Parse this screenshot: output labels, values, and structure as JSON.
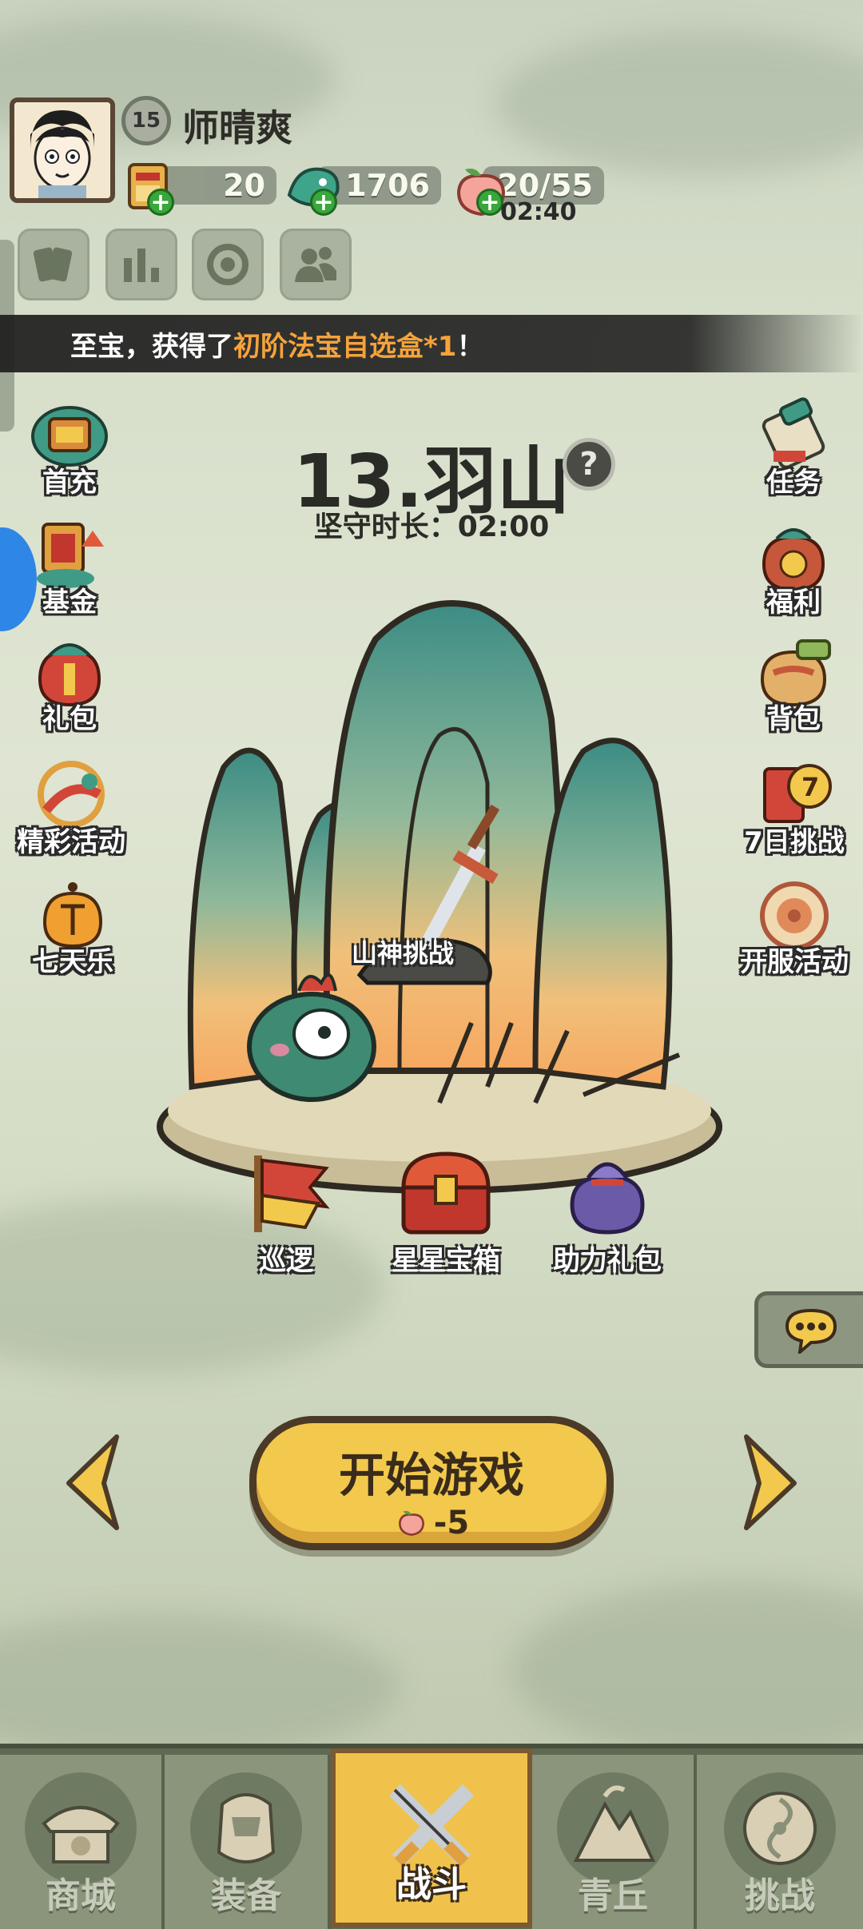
{
  "player": {
    "name": "师晴爽",
    "level": "15"
  },
  "resources": {
    "tickets": "20",
    "jade": "1706",
    "stamina": "20/55",
    "stamina_timer": "02:40"
  },
  "ticker": {
    "prefix": "至宝，获得了",
    "highlight": "初阶法宝自选盒*1",
    "suffix": "！"
  },
  "stage": {
    "title": "13.羽山",
    "hold_time": "坚守时长：02:00",
    "boss_label": "山神挑战"
  },
  "left_menu": [
    {
      "label": "首充",
      "icon": "first-recharge-icon"
    },
    {
      "label": "基金",
      "icon": "fund-icon"
    },
    {
      "label": "礼包",
      "icon": "gift-pack-icon"
    },
    {
      "label": "精彩活动",
      "icon": "events-icon"
    },
    {
      "label": "七天乐",
      "icon": "seven-day-icon"
    }
  ],
  "right_menu": [
    {
      "label": "任务",
      "icon": "quest-scroll-icon"
    },
    {
      "label": "福利",
      "icon": "welfare-bag-icon"
    },
    {
      "label": "背包",
      "icon": "backpack-icon"
    },
    {
      "label": "7日挑战",
      "icon": "seven-day-challenge-icon"
    },
    {
      "label": "开服活动",
      "icon": "server-opening-icon"
    }
  ],
  "stage_actions": [
    {
      "label": "巡逻",
      "icon": "patrol-flag-icon"
    },
    {
      "label": "星星宝箱",
      "icon": "star-chest-icon"
    },
    {
      "label": "助力礼包",
      "icon": "support-bag-icon"
    }
  ],
  "start_button": {
    "label": "开始游戏",
    "cost": "-5"
  },
  "nav": [
    {
      "label": "商城",
      "icon": "shop-icon"
    },
    {
      "label": "装备",
      "icon": "equipment-icon"
    },
    {
      "label": "战斗",
      "icon": "battle-icon"
    },
    {
      "label": "青丘",
      "icon": "qingqiu-icon"
    },
    {
      "label": "挑战",
      "icon": "challenge-icon"
    }
  ],
  "colors": {
    "accent_yellow": "#f2c94c",
    "ticker_highlight": "#f6a33b",
    "nav_bg": "#5f6a53"
  }
}
